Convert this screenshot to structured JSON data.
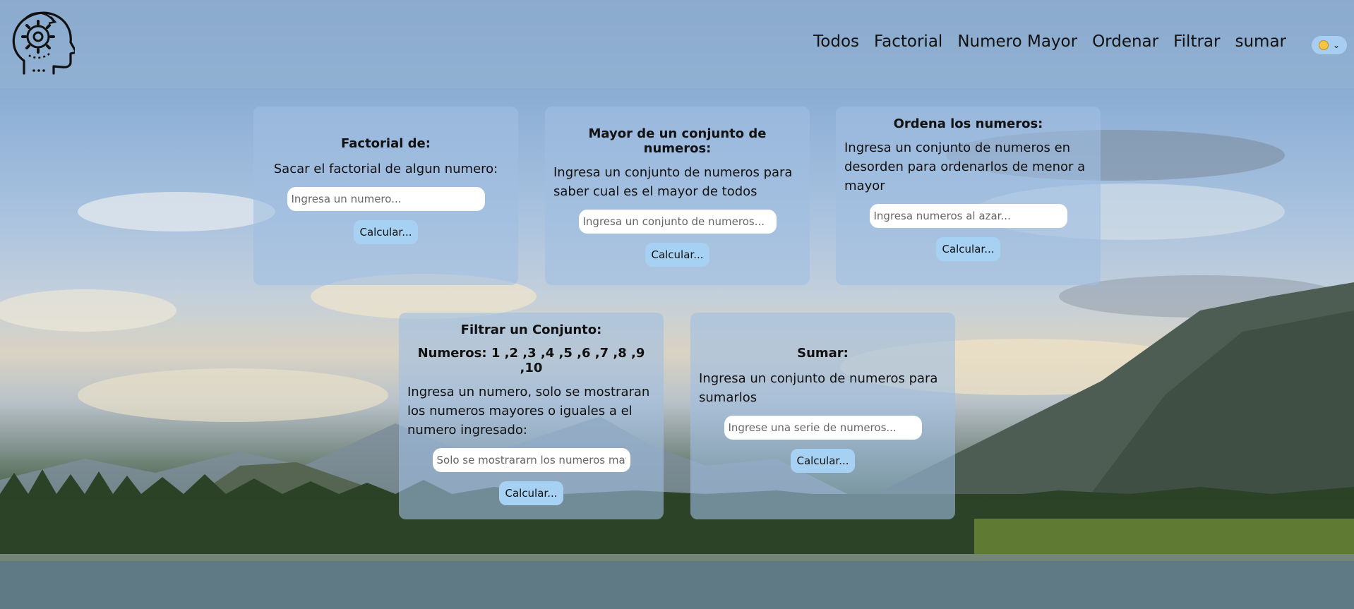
{
  "nav": {
    "items": [
      {
        "label": "Todos"
      },
      {
        "label": "Factorial"
      },
      {
        "label": "Numero Mayor"
      },
      {
        "label": "Ordenar"
      },
      {
        "label": "Filtrar"
      },
      {
        "label": "sumar"
      }
    ]
  },
  "theme_toggle": {
    "icon": "sun-icon",
    "chevron": "chevron-down-icon"
  },
  "cards": {
    "factorial": {
      "title": "Factorial de:",
      "description": "Sacar el factorial de algun numero:",
      "placeholder": "Ingresa un numero...",
      "button": "Calcular..."
    },
    "mayor": {
      "title": "Mayor de un conjunto de numeros:",
      "description": "Ingresa un conjunto de numeros para saber cual es el mayor de todos",
      "placeholder": "Ingresa un conjunto de numeros...",
      "button": "Calcular..."
    },
    "ordena": {
      "title": "Ordena los numeros:",
      "description": "Ingresa un conjunto de numeros en desorden para ordenarlos de menor a mayor",
      "placeholder": "Ingresa numeros al azar...",
      "button": "Calcular..."
    },
    "filtrar": {
      "title": "Filtrar un Conjunto:",
      "numbers": "Numeros: 1 ,2 ,3 ,4 ,5 ,6 ,7 ,8 ,9 ,10",
      "description": "Ingresa un numero, solo se mostraran los numeros mayores o iguales a el numero ingresado:",
      "placeholder": "Solo se mostrararn los numeros mayores",
      "button": "Calcular..."
    },
    "sumar": {
      "title": "Sumar:",
      "description": "Ingresa un conjunto de numeros para sumarlos",
      "placeholder": "Ingrese una serie de numeros...",
      "button": "Calcular..."
    }
  },
  "colors": {
    "header_bg": "#96b4d4",
    "card_bg": "#a0bee1",
    "button_bg": "#a6d1f3",
    "input_bg": "#ffffff"
  }
}
